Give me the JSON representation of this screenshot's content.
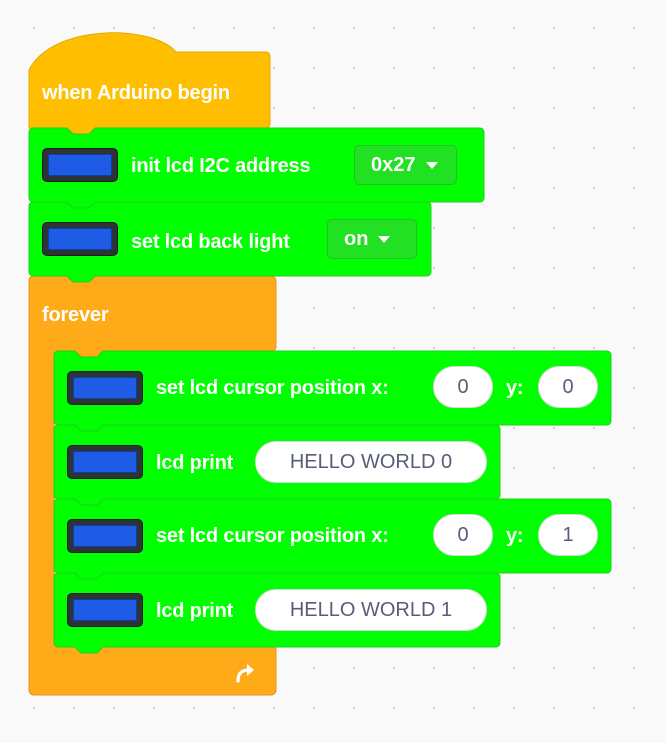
{
  "colors": {
    "event_block": "#ffbf00",
    "control_block": "#ffab19",
    "lcd_block": "#00ff00",
    "lcd_screen": "#1e5ce6",
    "input_text": "#575e75"
  },
  "blocks": {
    "when_arduino_begin": {
      "label": "when Arduino begin"
    },
    "init_lcd": {
      "label": "init lcd I2C address",
      "address": "0x27",
      "icon": "lcd-icon"
    },
    "backlight": {
      "label": "set lcd back light",
      "state": "on",
      "icon": "lcd-icon"
    },
    "forever": {
      "label": "forever",
      "loop_icon": "loop-arrow-icon"
    },
    "cursor_1": {
      "label": "set lcd cursor position x:",
      "y_label": "y:",
      "x": "0",
      "y": "0"
    },
    "print_1": {
      "label": "lcd print",
      "text": "HELLO WORLD 0"
    },
    "cursor_2": {
      "label": "set lcd cursor position x:",
      "y_label": "y:",
      "x": "0",
      "y": "1"
    },
    "print_2": {
      "label": "lcd print",
      "text": "HELLO WORLD 1"
    }
  }
}
